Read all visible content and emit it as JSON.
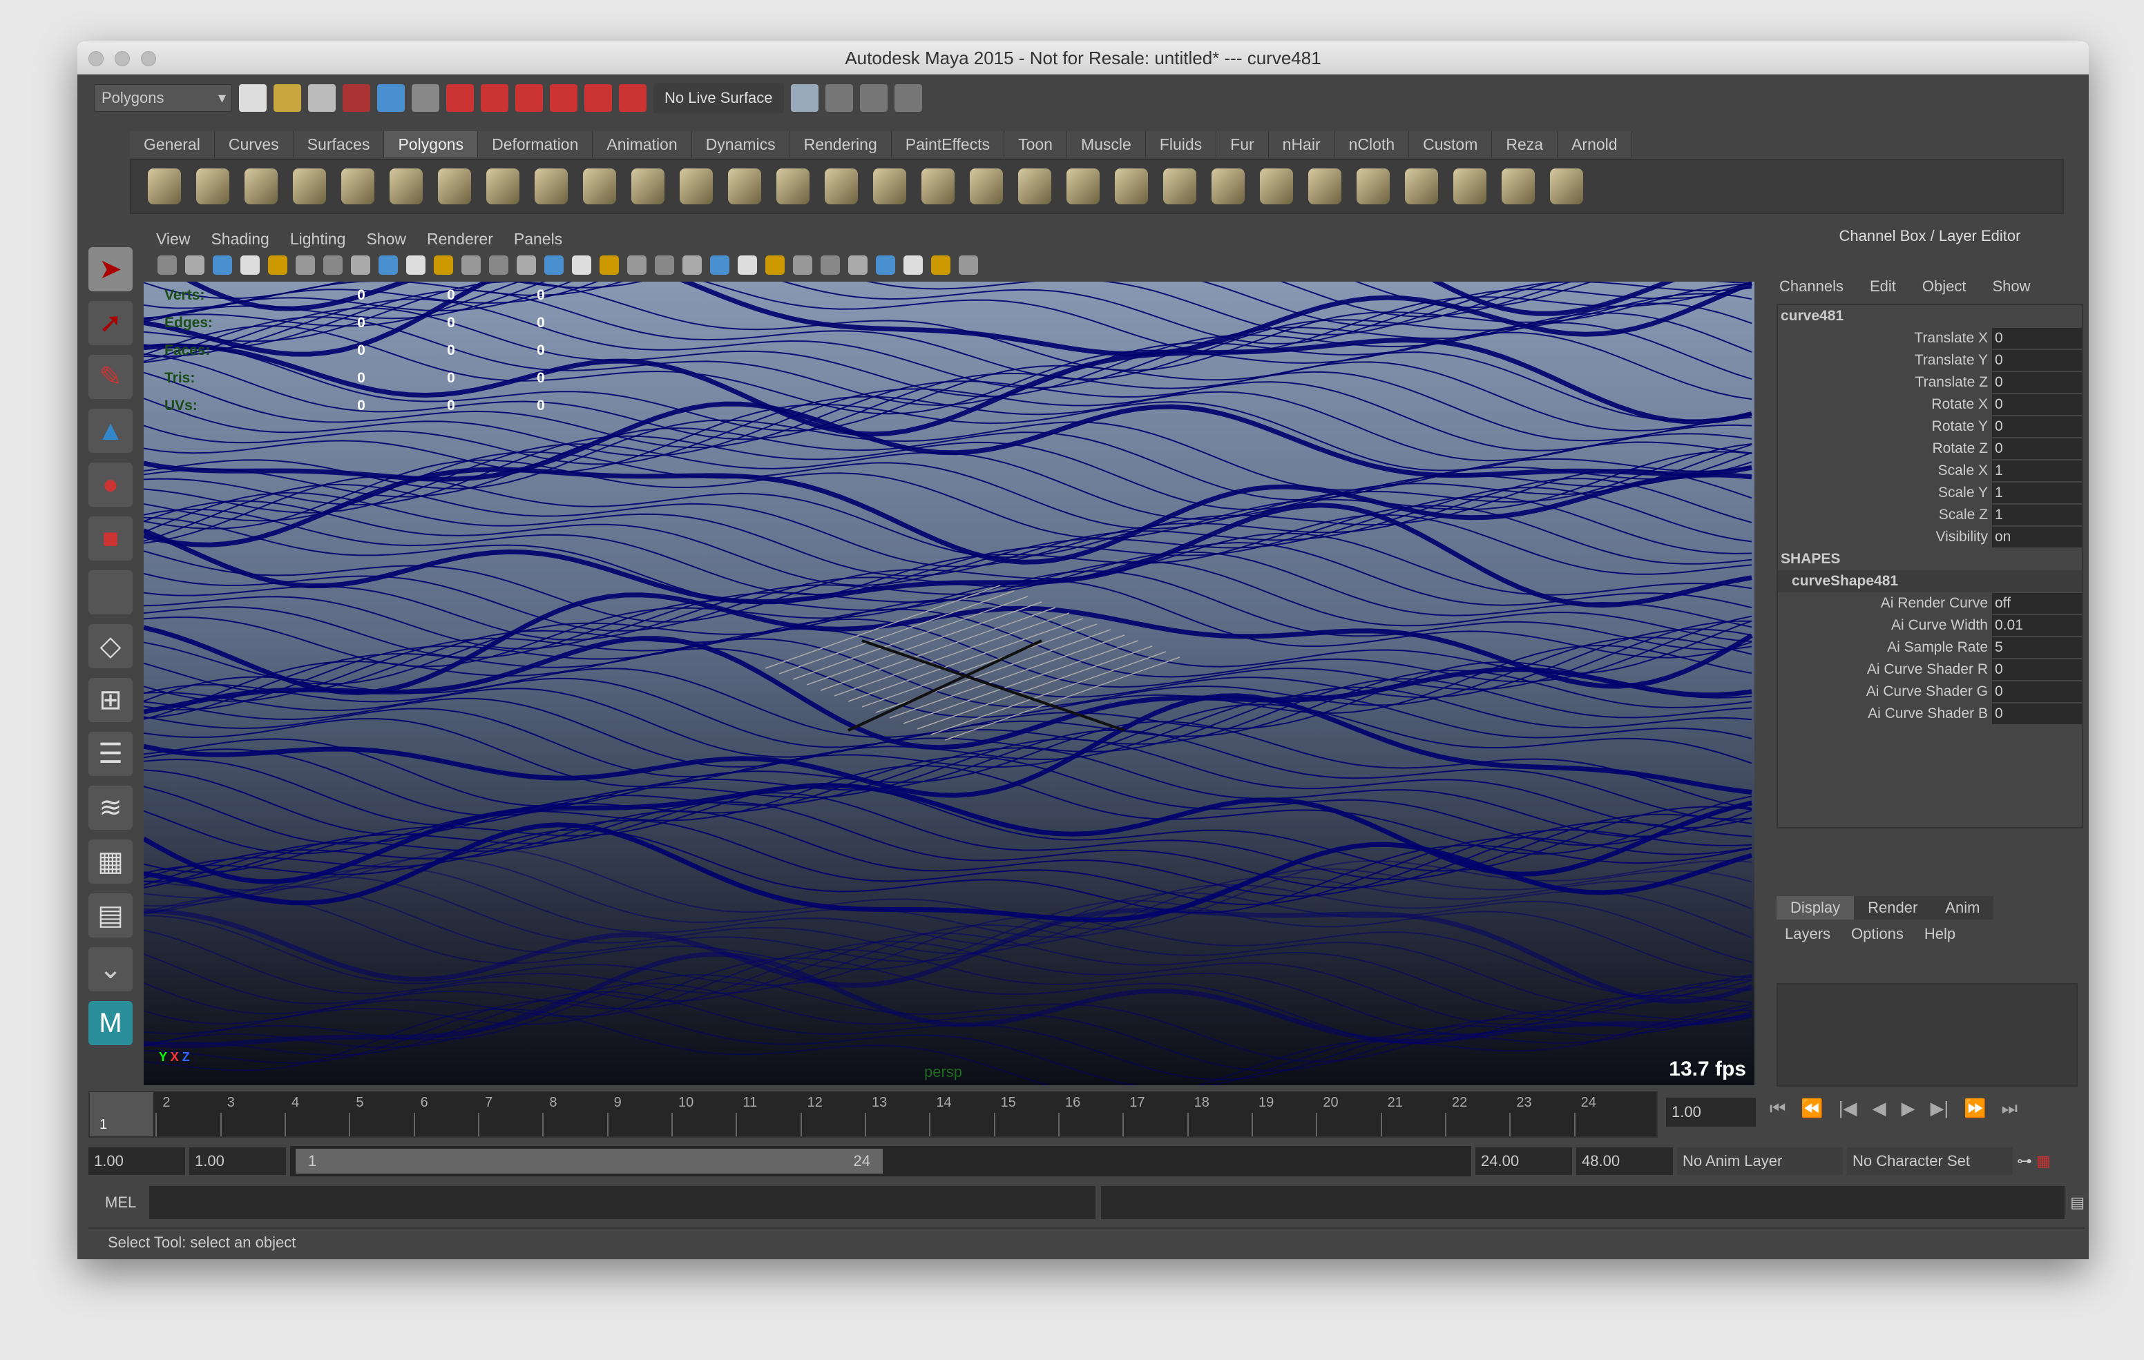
{
  "window": {
    "title": "Autodesk Maya 2015 - Not for Resale: untitled*   ---   curve481"
  },
  "toolbar": {
    "menu_set": "Polygons",
    "live_surface": "No Live Surface"
  },
  "shelf": {
    "tabs": [
      "General",
      "Curves",
      "Surfaces",
      "Polygons",
      "Deformation",
      "Animation",
      "Dynamics",
      "Rendering",
      "PaintEffects",
      "Toon",
      "Muscle",
      "Fluids",
      "Fur",
      "nHair",
      "nCloth",
      "Custom",
      "Reza",
      "Arnold"
    ],
    "active": "Polygons"
  },
  "panel": {
    "menus": [
      "View",
      "Shading",
      "Lighting",
      "Show",
      "Renderer",
      "Panels"
    ]
  },
  "viewport": {
    "hud": [
      {
        "label": "Verts:",
        "values": [
          "0",
          "0",
          "0"
        ]
      },
      {
        "label": "Edges:",
        "values": [
          "0",
          "0",
          "0"
        ]
      },
      {
        "label": "Faces:",
        "values": [
          "0",
          "0",
          "0"
        ]
      },
      {
        "label": "Tris:",
        "values": [
          "0",
          "0",
          "0"
        ]
      },
      {
        "label": "UVs:",
        "values": [
          "0",
          "0",
          "0"
        ]
      }
    ],
    "camera": "persp",
    "fps": "13.7 fps",
    "axis": {
      "y": "Y",
      "x": "X",
      "z": "Z"
    },
    "wire_color": "#00006e"
  },
  "channel_box": {
    "title": "Channel Box / Layer Editor",
    "menus": [
      "Channels",
      "Edit",
      "Object",
      "Show"
    ],
    "object": "curve481",
    "attrs": [
      {
        "n": "Translate X",
        "v": "0"
      },
      {
        "n": "Translate Y",
        "v": "0"
      },
      {
        "n": "Translate Z",
        "v": "0"
      },
      {
        "n": "Rotate X",
        "v": "0"
      },
      {
        "n": "Rotate Y",
        "v": "0"
      },
      {
        "n": "Rotate Z",
        "v": "0"
      },
      {
        "n": "Scale X",
        "v": "1"
      },
      {
        "n": "Scale Y",
        "v": "1"
      },
      {
        "n": "Scale Z",
        "v": "1"
      },
      {
        "n": "Visibility",
        "v": "on"
      }
    ],
    "shapes_label": "SHAPES",
    "shape": "curveShape481",
    "shape_attrs": [
      {
        "n": "Ai Render Curve",
        "v": "off"
      },
      {
        "n": "Ai Curve Width",
        "v": "0.01"
      },
      {
        "n": "Ai Sample Rate",
        "v": "5"
      },
      {
        "n": "Ai Curve Shader R",
        "v": "0"
      },
      {
        "n": "Ai Curve Shader G",
        "v": "0"
      },
      {
        "n": "Ai Curve Shader B",
        "v": "0"
      }
    ]
  },
  "layers": {
    "tabs": [
      "Display",
      "Render",
      "Anim"
    ],
    "active": "Display",
    "menus": [
      "Layers",
      "Options",
      "Help"
    ]
  },
  "timeline": {
    "ticks": [
      "1",
      "2",
      "3",
      "4",
      "5",
      "6",
      "7",
      "8",
      "9",
      "10",
      "11",
      "12",
      "13",
      "14",
      "15",
      "16",
      "17",
      "18",
      "19",
      "20",
      "21",
      "22",
      "23",
      "24"
    ],
    "current_frame": "1.00",
    "current_marker": "1"
  },
  "range": {
    "start": "1.00",
    "playback_start": "1.00",
    "slider_start": "1",
    "slider_end": "24",
    "playback_end": "24.00",
    "end": "48.00",
    "anim_layer": "No Anim Layer",
    "character_set": "No Character Set"
  },
  "command": {
    "label": "MEL"
  },
  "help_line": "Select Tool: select an object"
}
